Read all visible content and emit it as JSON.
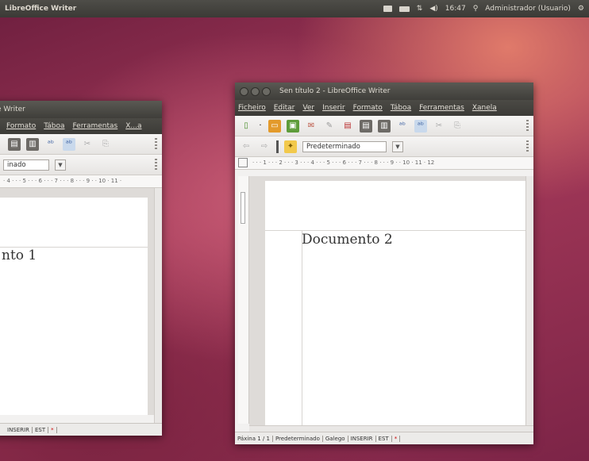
{
  "top_panel": {
    "app_name": "LibreOffice Writer",
    "clock": "16:47",
    "user": "Administrador (Usuario)",
    "icons": [
      "mail-icon",
      "battery-icon",
      "network-icon",
      "volume-icon",
      "user-icon",
      "power-icon"
    ]
  },
  "window_left": {
    "title": "e Writer",
    "menus": [
      "Formato",
      "Táboa",
      "Ferramentas",
      "X...a"
    ],
    "style_value": "inado",
    "ruler_text": "· 4 · · · 5 · · · 6 · · · 7 · · · 8 · · · 9 · · 10 · 11 ·",
    "doc_text": "nto 1",
    "status": [
      "INSERIR",
      "EST",
      "*"
    ]
  },
  "window_right": {
    "title": "Sen título 2 - LibreOffice Writer",
    "menus": [
      "Ficheiro",
      "Editar",
      "Ver",
      "Inserir",
      "Formato",
      "Táboa",
      "Ferramentas",
      "Xanela"
    ],
    "style_value": "Predeterminado",
    "ruler_text": "· · · 1 · · · 2 · · · 3 · · · 4 · · · 5 · · · 6 · · · 7 · · · 8 · · · 9 · · 10 · 11 · 12",
    "doc_text": "Documento 2",
    "status": [
      "Páxina 1 / 1",
      "Predeterminado",
      "Galego",
      "INSERIR",
      "EST",
      "*"
    ]
  }
}
